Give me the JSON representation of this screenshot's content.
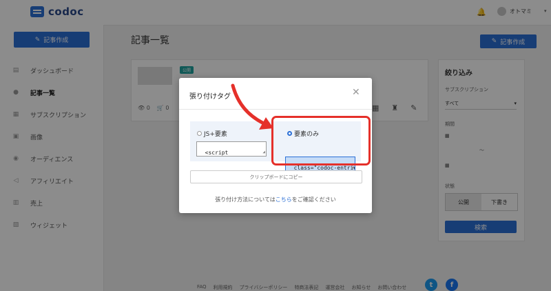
{
  "app": {
    "logo_text": "codoc"
  },
  "sidebar": {
    "create_label": "記事作成",
    "items": [
      {
        "label": "ダッシュボード",
        "icon": "dashboard-icon"
      },
      {
        "label": "記事一覧",
        "icon": "list-icon",
        "active": true
      },
      {
        "label": "サブスクリプション",
        "icon": "subscription-icon"
      },
      {
        "label": "画像",
        "icon": "image-icon"
      },
      {
        "label": "オーディエンス",
        "icon": "audience-icon"
      },
      {
        "label": "アフィリエイト",
        "icon": "affiliate-icon"
      },
      {
        "label": "売上",
        "icon": "sales-icon"
      },
      {
        "label": "ウィジェット",
        "icon": "widget-icon"
      }
    ]
  },
  "header": {
    "username": "オトマミ"
  },
  "main": {
    "title": "記事一覧",
    "create_label": "記事作成",
    "card": {
      "badge": "公開",
      "views": "0",
      "purchases": "0"
    }
  },
  "filter": {
    "title": "絞り込み",
    "subscription_label": "サブスクリプション",
    "subscription_value": "すべて",
    "period_label": "期間",
    "period_separator": "〜",
    "status_label": "状態",
    "status_options": [
      "公開",
      "下書き"
    ],
    "search_label": "検索"
  },
  "footer": {
    "links": [
      "FAQ",
      "利用規約",
      "プライバシーポリシー",
      "特商法表記",
      "運営会社",
      "お知らせ",
      "お問い合わせ"
    ],
    "twitter": "t",
    "facebook": "f"
  },
  "modal": {
    "title": "張り付けタグ",
    "option_js": "JS+要素",
    "option_element": "要素のみ",
    "js_code": "<script\nsrc=\"https://codoc.jp",
    "element_code": "class=\"codoc-entries\"\ndata-support-button-",
    "copy_label": "クリップボードにコピー",
    "help_prefix": "張り付け方法については",
    "help_link": "こちら",
    "help_suffix": "をご確認ください"
  },
  "colors": {
    "accent": "#2b6fd6",
    "highlight": "#e5302a",
    "badge": "#20a39e"
  }
}
